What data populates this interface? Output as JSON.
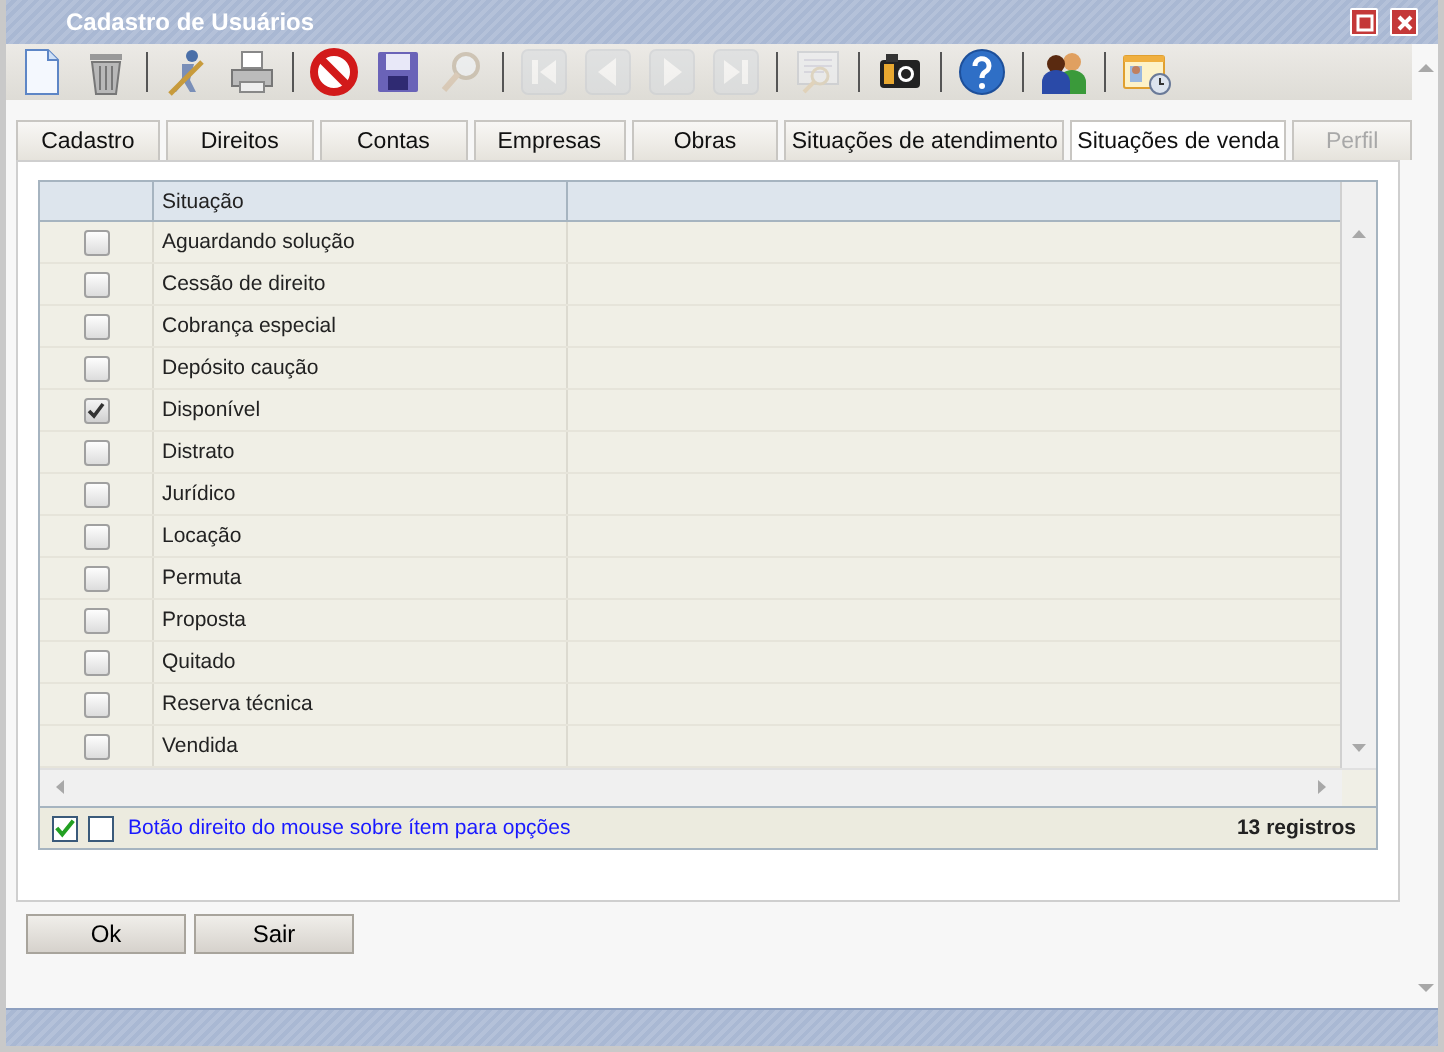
{
  "window": {
    "title": "Cadastro de Usuários"
  },
  "toolbar": [
    {
      "kind": "new",
      "disabled": false
    },
    {
      "kind": "delete",
      "disabled": false
    },
    {
      "kind": "separator"
    },
    {
      "kind": "edit-user",
      "disabled": false
    },
    {
      "kind": "print",
      "disabled": false
    },
    {
      "kind": "separator"
    },
    {
      "kind": "cancel",
      "disabled": false
    },
    {
      "kind": "save",
      "disabled": false
    },
    {
      "kind": "search",
      "disabled": true
    },
    {
      "kind": "separator"
    },
    {
      "kind": "first",
      "disabled": true
    },
    {
      "kind": "prev",
      "disabled": true
    },
    {
      "kind": "next",
      "disabled": true
    },
    {
      "kind": "last",
      "disabled": true
    },
    {
      "kind": "separator"
    },
    {
      "kind": "preview",
      "disabled": true
    },
    {
      "kind": "separator"
    },
    {
      "kind": "camera",
      "disabled": false
    },
    {
      "kind": "separator"
    },
    {
      "kind": "help",
      "disabled": false
    },
    {
      "kind": "separator"
    },
    {
      "kind": "users",
      "disabled": false
    },
    {
      "kind": "separator"
    },
    {
      "kind": "id-card",
      "disabled": false
    }
  ],
  "tabs": [
    {
      "label": "Cadastro",
      "selected": false,
      "disabled": false
    },
    {
      "label": "Direitos",
      "selected": false,
      "disabled": false
    },
    {
      "label": "Contas",
      "selected": false,
      "disabled": false
    },
    {
      "label": "Empresas",
      "selected": false,
      "disabled": false
    },
    {
      "label": "Obras",
      "selected": false,
      "disabled": false
    },
    {
      "label": "Situações de atendimento",
      "selected": false,
      "disabled": false
    },
    {
      "label": "Situações de venda",
      "selected": true,
      "disabled": false
    },
    {
      "label": "Perfil",
      "selected": false,
      "disabled": true
    }
  ],
  "table": {
    "columns": [
      "Situação"
    ],
    "rows": [
      {
        "checked": false,
        "situacao": "Aguardando solução"
      },
      {
        "checked": false,
        "situacao": "Cessão de direito"
      },
      {
        "checked": false,
        "situacao": "Cobrança especial"
      },
      {
        "checked": false,
        "situacao": "Depósito caução"
      },
      {
        "checked": true,
        "situacao": "Disponível"
      },
      {
        "checked": false,
        "situacao": "Distrato"
      },
      {
        "checked": false,
        "situacao": "Jurídico"
      },
      {
        "checked": false,
        "situacao": "Locação"
      },
      {
        "checked": false,
        "situacao": "Permuta"
      },
      {
        "checked": false,
        "situacao": "Proposta"
      },
      {
        "checked": false,
        "situacao": "Quitado"
      },
      {
        "checked": false,
        "situacao": "Reserva técnica"
      },
      {
        "checked": false,
        "situacao": "Vendida"
      }
    ]
  },
  "footer": {
    "hint": "Botão direito do mouse sobre ítem para opções",
    "count": "13 registros"
  },
  "buttons": [
    "Ok",
    "Sair"
  ]
}
